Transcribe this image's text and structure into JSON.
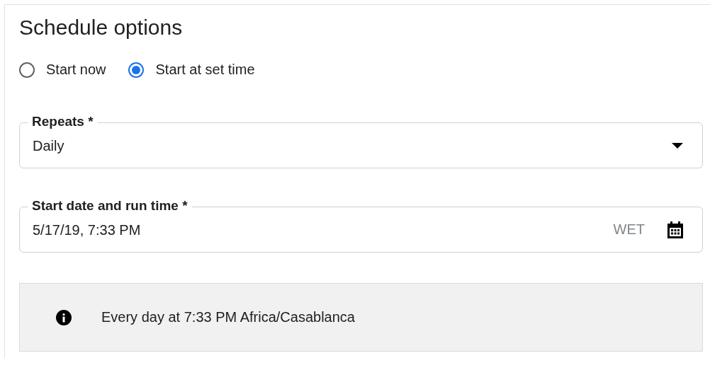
{
  "title": "Schedule options",
  "start_options": [
    {
      "label": "Start now",
      "selected": false
    },
    {
      "label": "Start at set time",
      "selected": true
    }
  ],
  "repeats": {
    "label": "Repeats *",
    "value": "Daily"
  },
  "start_time": {
    "label": "Start date and run time *",
    "value": "5/17/19, 7:33 PM",
    "timezone": "WET"
  },
  "info": "Every day at 7:33 PM Africa/Casablanca"
}
